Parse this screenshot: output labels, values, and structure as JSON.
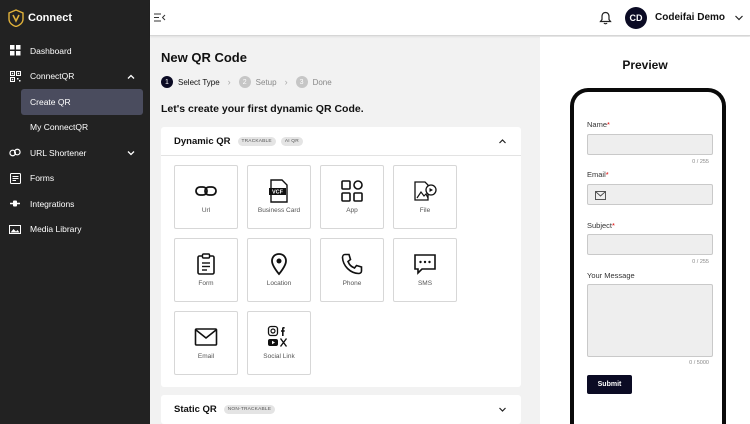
{
  "brand": {
    "name": "Connect"
  },
  "sidebar": {
    "items": [
      {
        "label": "Dashboard",
        "icon": "dashboard-icon"
      },
      {
        "label": "ConnectQR",
        "icon": "qr-code-icon"
      },
      {
        "label": "Create QR",
        "active": true
      },
      {
        "label": "My ConnectQR"
      },
      {
        "label": "URL Shortener",
        "icon": "link-icon"
      },
      {
        "label": "Forms",
        "icon": "forms-icon"
      },
      {
        "label": "Integrations",
        "icon": "integrations-icon"
      },
      {
        "label": "Media Library",
        "icon": "media-library-icon"
      }
    ]
  },
  "header": {
    "avatar_initials": "CD",
    "user_name": "Codeifai Demo"
  },
  "main": {
    "title": "New QR Code",
    "steps": [
      {
        "num": "1",
        "label": "Select Type",
        "active": true
      },
      {
        "num": "2",
        "label": "Setup"
      },
      {
        "num": "3",
        "label": "Done"
      }
    ],
    "subtitle": "Let's create your first dynamic QR Code.",
    "dynamic": {
      "title": "Dynamic QR",
      "badges": [
        "TRACKABLE",
        "AI QR"
      ],
      "tiles": [
        {
          "label": "Url",
          "icon": "link-icon"
        },
        {
          "label": "Business Card",
          "icon": "vcf-icon"
        },
        {
          "label": "App",
          "icon": "app-grid-icon"
        },
        {
          "label": "File",
          "icon": "file-icon"
        },
        {
          "label": "Form",
          "icon": "clipboard-icon"
        },
        {
          "label": "Location",
          "icon": "location-pin-icon"
        },
        {
          "label": "Phone",
          "icon": "phone-icon"
        },
        {
          "label": "SMS",
          "icon": "sms-icon"
        },
        {
          "label": "Email",
          "icon": "email-icon"
        },
        {
          "label": "Social Link",
          "icon": "social-icons"
        }
      ]
    },
    "static": {
      "title": "Static QR",
      "badge": "NON-TRACKABLE"
    }
  },
  "preview": {
    "title": "Preview",
    "fields": {
      "name": {
        "label": "Name",
        "required": "*",
        "counter": "0 / 255"
      },
      "email": {
        "label": "Email",
        "required": "*"
      },
      "subject": {
        "label": "Subject",
        "required": "*",
        "counter": "0 / 255"
      },
      "message": {
        "label": "Your Message",
        "counter": "0 / 5000"
      }
    },
    "submit_label": "Submit"
  },
  "colors": {
    "sidebar_bg": "#222222",
    "accent": "#0b0b24",
    "active_item": "#4a4c5e"
  }
}
